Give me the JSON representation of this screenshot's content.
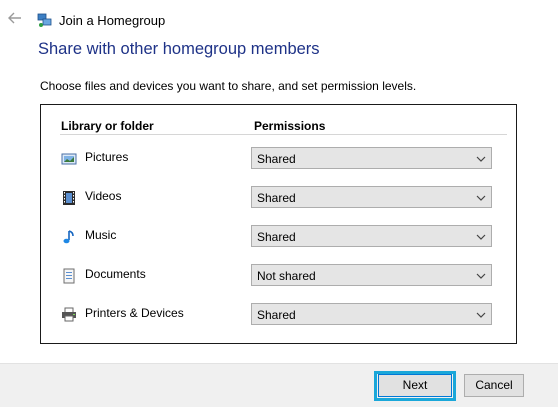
{
  "window": {
    "title": "Join a Homegroup",
    "back_icon": "back-arrow-icon",
    "app_icon": "homegroup-icon"
  },
  "heading": "Share with other homegroup members",
  "instruction": "Choose files and devices you want to share, and set permission levels.",
  "table": {
    "col_library": "Library or folder",
    "col_permissions": "Permissions",
    "rows": [
      {
        "label": "Pictures",
        "icon": "pictures-icon",
        "permission": "Shared"
      },
      {
        "label": "Videos",
        "icon": "videos-icon",
        "permission": "Shared"
      },
      {
        "label": "Music",
        "icon": "music-icon",
        "permission": "Shared"
      },
      {
        "label": "Documents",
        "icon": "documents-icon",
        "permission": "Not shared"
      },
      {
        "label": "Printers & Devices",
        "icon": "printers-icon",
        "permission": "Shared"
      }
    ]
  },
  "buttons": {
    "next": "Next",
    "cancel": "Cancel"
  },
  "colors": {
    "heading": "#1e3287",
    "highlight": "#1aa7d9",
    "footer": "#f0f0f0"
  }
}
